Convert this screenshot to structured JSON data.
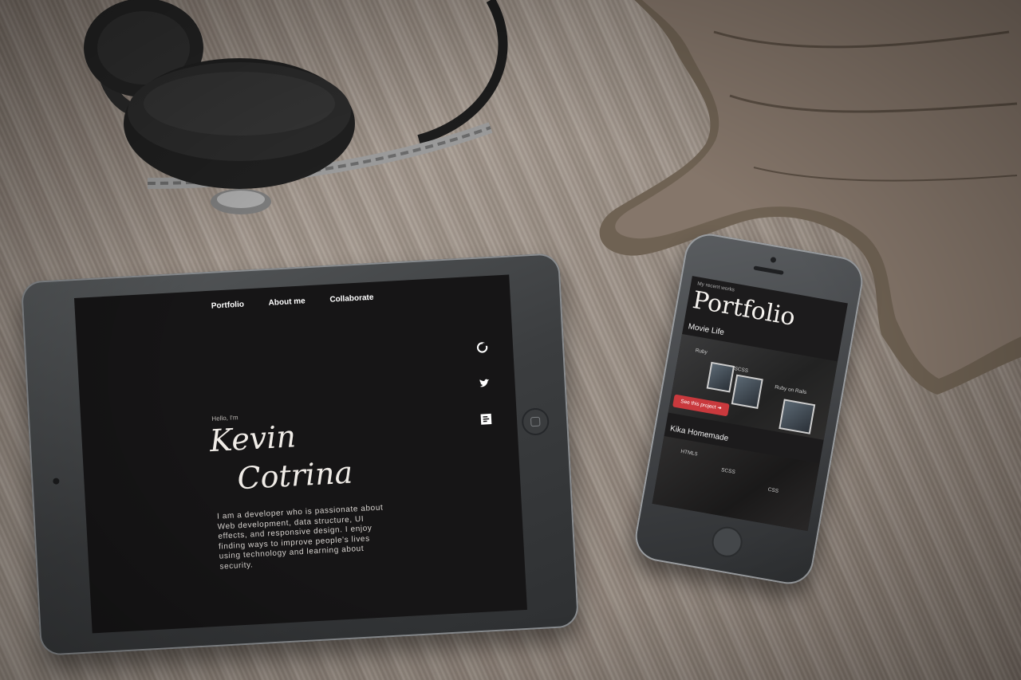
{
  "tablet": {
    "nav": [
      "Portfolio",
      "About me",
      "Collaborate"
    ],
    "hello": "Hello, I'm",
    "first_name": "Kevin",
    "last_name": "Cotrina",
    "bio": "I am a developer who is passionate about Web development, data structure, UI effects, and responsive design. I enjoy finding ways to improve people's lives using technology and learning about security.",
    "social_icons": [
      "github-icon",
      "twitter-icon",
      "medium-icon"
    ]
  },
  "phone": {
    "subtitle": "My recent works",
    "title": "Portfolio",
    "project1": {
      "name": "Movie Life",
      "tags": [
        "Ruby",
        "SCSS",
        "Ruby on Rails"
      ],
      "button": "See this project"
    },
    "project2": {
      "name": "Kika Homemade",
      "tags": [
        "HTML5",
        "SCSS",
        "CSS"
      ]
    }
  },
  "colors": {
    "screen_bg": "#161516",
    "button_red": "#c9393d"
  }
}
